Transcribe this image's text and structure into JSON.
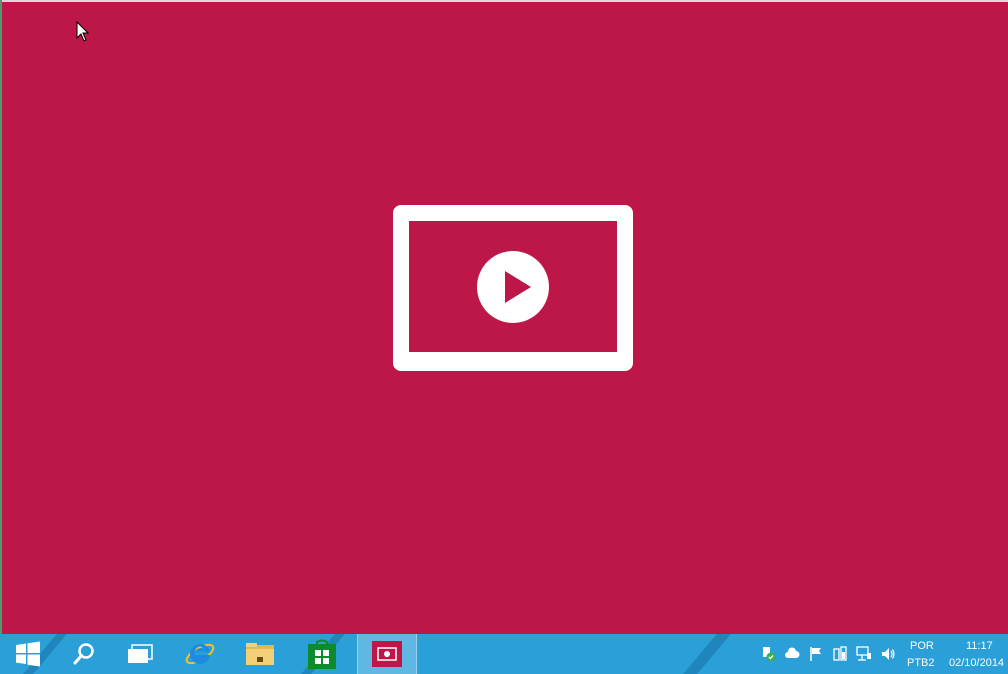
{
  "app": {
    "name": "Video",
    "accent_color": "#bc1748",
    "splash_icon": "video-play-icon"
  },
  "taskbar": {
    "color": "#2a9fd8",
    "pinned": [
      {
        "id": "start",
        "icon": "windows-logo-icon"
      },
      {
        "id": "search",
        "icon": "search-icon"
      },
      {
        "id": "task-view",
        "icon": "task-view-icon"
      },
      {
        "id": "internet-explorer",
        "icon": "internet-explorer-icon"
      },
      {
        "id": "file-explorer",
        "icon": "folder-icon"
      },
      {
        "id": "store",
        "icon": "store-icon"
      },
      {
        "id": "video-app",
        "icon": "video-app-icon",
        "active": true
      }
    ],
    "tray": {
      "icons": [
        "security-shield-icon",
        "onedrive-cloud-icon",
        "action-center-flag-icon",
        "power-icon",
        "network-icon",
        "volume-icon"
      ],
      "language": "POR",
      "keyboard": "PTB2",
      "time": "11:17",
      "date": "02/10/2014"
    }
  }
}
